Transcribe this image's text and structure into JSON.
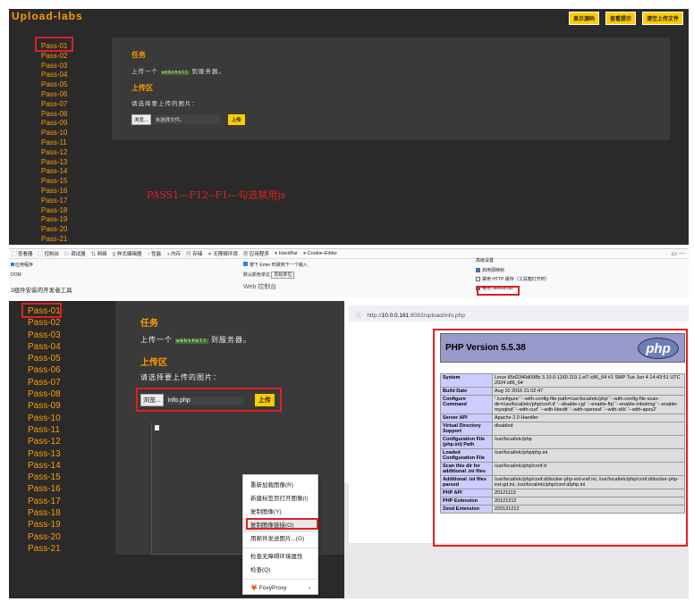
{
  "top": {
    "logo": "Upload-labs",
    "buttons": [
      "显示源码",
      "查看提示",
      "清空上传文件"
    ],
    "nav": [
      "Pass-01",
      "Pass-02",
      "Pass-03",
      "Pass-04",
      "Pass-05",
      "Pass-06",
      "Pass-07",
      "Pass-08",
      "Pass-09",
      "Pass-10",
      "Pass-11",
      "Pass-12",
      "Pass-13",
      "Pass-14",
      "Pass-15",
      "Pass-16",
      "Pass-17",
      "Pass-18",
      "Pass-19",
      "Pass-20",
      "Pass-21"
    ],
    "task_title": "任务",
    "task_text_pre": "上传一个",
    "task_code": "webshell",
    "task_text_post": "到服务器。",
    "upload_title": "上传区",
    "upload_prompt": "请选择要上传的图片：",
    "browse_label": "浏览...",
    "file_value": "未选择文件。",
    "upload_btn": "上传",
    "annotation": "PASS1---F12--F1---勾选禁用js"
  },
  "devtools": {
    "tabs": [
      "查看器",
      "控制台",
      "调试器",
      "网络",
      "样式编辑器",
      "性能",
      "内存",
      "存储",
      "无障碍环境",
      "应用程序",
      "HackBar",
      "Cookie-Editor"
    ],
    "left_items": [
      "应用程序",
      "DOM"
    ],
    "left_note": "览器工具",
    "left_footer": "3组件安装的开发者工具",
    "mid_check": "按下 Enter 时跳到下一个输入",
    "mid_unit_label": "默认颜色单位",
    "mid_unit_value": "原始单位",
    "mid_footer": "Web 控制台",
    "right_title": "高级设置",
    "right_items": [
      {
        "label": "启用源映射",
        "checked": true
      },
      {
        "label": "禁用 HTTP 缓存（工具箱打开时）",
        "checked": false
      },
      {
        "label": "禁用 JavaScript *",
        "checked": true
      }
    ]
  },
  "bottom": {
    "nav": [
      "Pass-01",
      "Pass-02",
      "Pass-03",
      "Pass-04",
      "Pass-05",
      "Pass-06",
      "Pass-07",
      "Pass-08",
      "Pass-09",
      "Pass-10",
      "Pass-11",
      "Pass-12",
      "Pass-13",
      "Pass-14",
      "Pass-15",
      "Pass-16",
      "Pass-17",
      "Pass-18",
      "Pass-19",
      "Pass-20",
      "Pass-21"
    ],
    "task_title": "任务",
    "task_text_pre": "上传一个",
    "task_code": "webshell",
    "task_text_post": "到服务器。",
    "upload_title": "上传区",
    "upload_prompt": "请选择要上传的图片：",
    "browse_label": "浏览...",
    "file_value": "info.php",
    "upload_btn": "上传",
    "context_menu": [
      "重新加载图像(R)",
      "新建标签页打开图像(I)",
      "复制图像(Y)",
      "复制图像链接(O)",
      "用邮件发送图片...(G)",
      "检查无障碍环境属性",
      "检查(Q)",
      "FoxyProxy"
    ],
    "url_prefix": "http://",
    "url_host": "10.0.0.161",
    "url_rest": ":8083/upload/info.php",
    "php_title": "PHP Version 5.5.38",
    "php_logo": "php",
    "php_rows": [
      {
        "k": "System",
        "v": "Linux 85d2340d098b 3.10.0-1160.119.1.el7.x86_64 #1 SMP Tue Jun 4 14:43:51 UTC 2024 x86_64"
      },
      {
        "k": "Build Date",
        "v": "Aug 10 2016 21:02:47"
      },
      {
        "k": "Configure Command",
        "v": "'./configure' '--with-config-file-path=/usr/local/etc/php' '--with-config-file-scan-dir=/usr/local/etc/php/conf.d' '--disable-cgi' '--enable-ftp' '--enable-mbstring' '--enable-mysqlnd' '--with-curl' '--with-libedit' '--with-openssl' '--with-zlib' '--with-apxs2'"
      },
      {
        "k": "Server API",
        "v": "Apache 2.0 Handler"
      },
      {
        "k": "Virtual Directory Support",
        "v": "disabled"
      },
      {
        "k": "Configuration File (php.ini) Path",
        "v": "/usr/local/etc/php"
      },
      {
        "k": "Loaded Configuration File",
        "v": "/usr/local/etc/php/php.ini"
      },
      {
        "k": "Scan this dir for additional .ini files",
        "v": "/usr/local/etc/php/conf.d"
      },
      {
        "k": "Additional .ini files parsed",
        "v": "/usr/local/etc/php/conf.d/docker-php-ext-exif.ini, /usr/local/etc/php/conf.d/docker-php-ext-gd.ini, /usr/local/etc/php/conf.d/php.ini"
      },
      {
        "k": "PHP API",
        "v": "20121113"
      },
      {
        "k": "PHP Extension",
        "v": "20121212"
      },
      {
        "k": "Zend Extension",
        "v": "220121212"
      }
    ]
  }
}
